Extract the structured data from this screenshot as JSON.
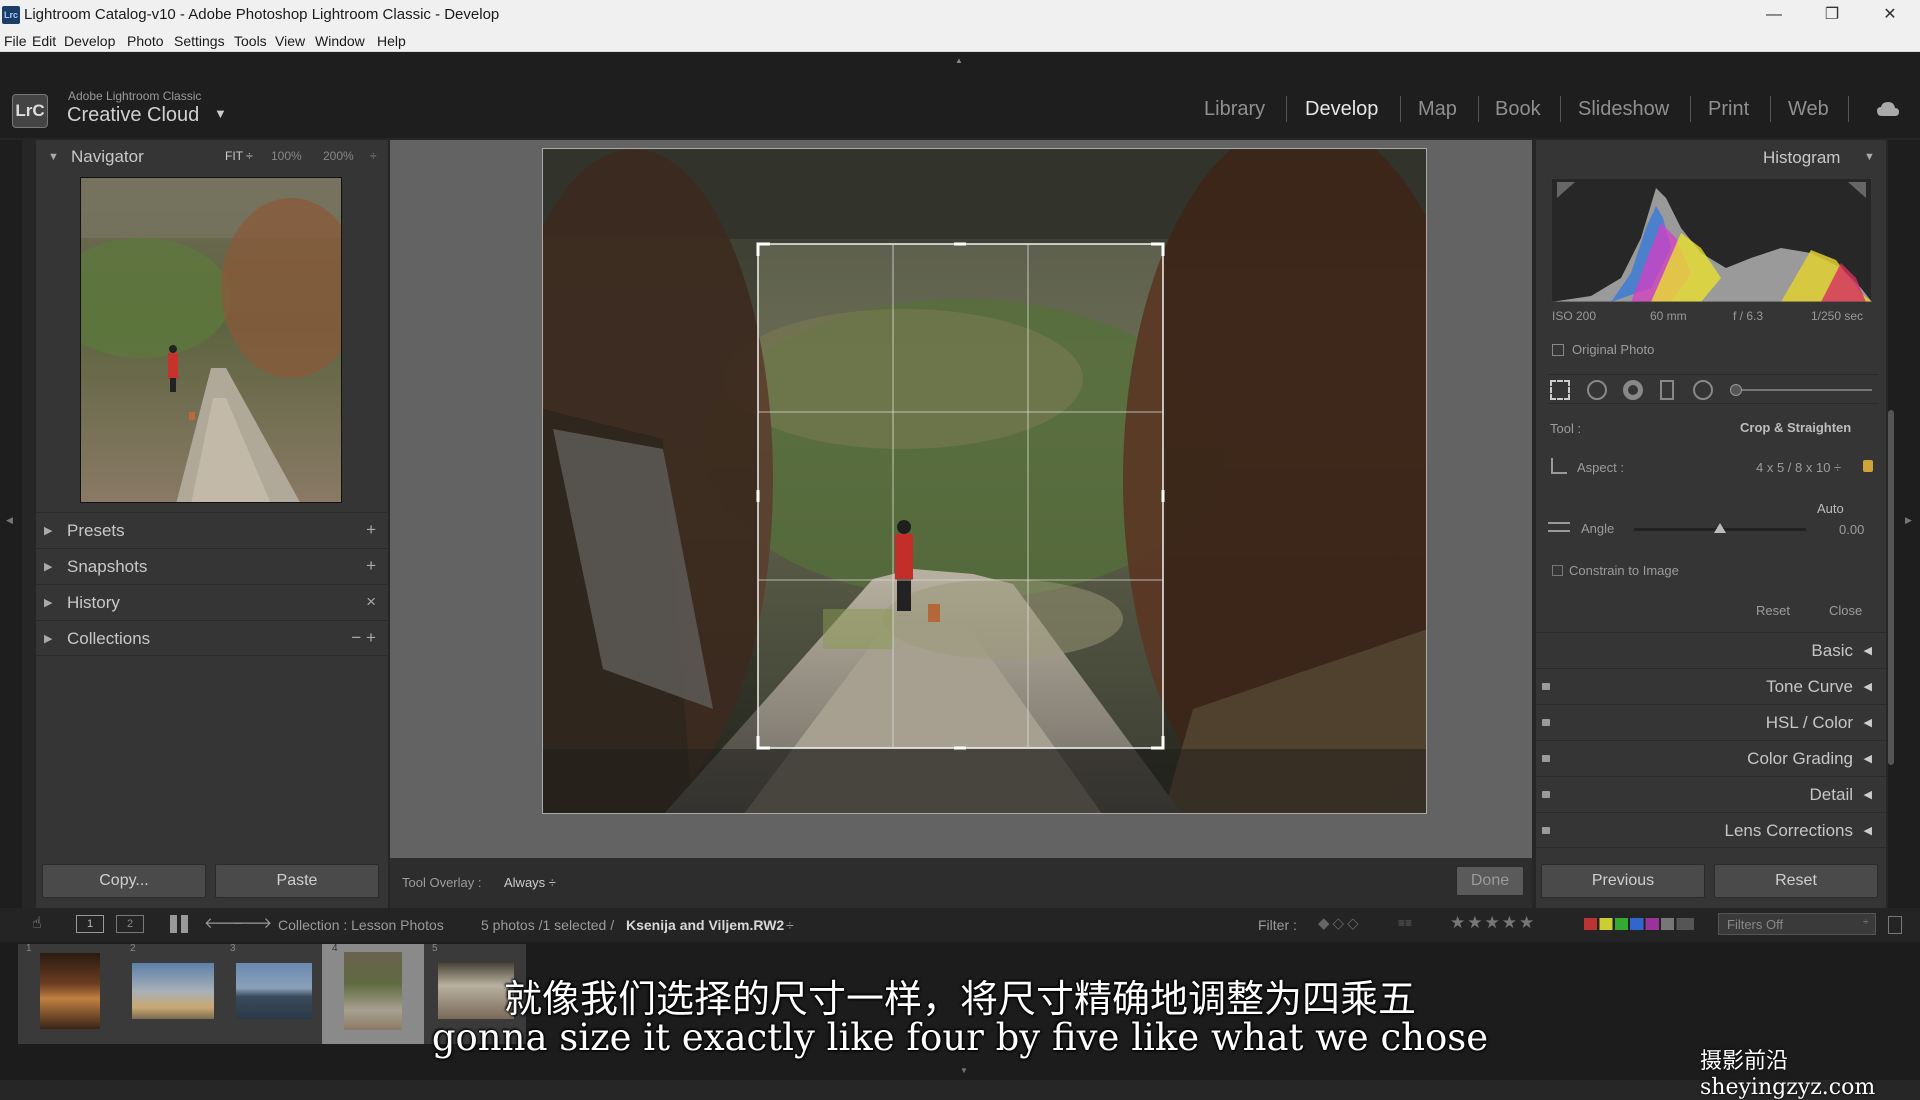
{
  "window": {
    "title": "Lightroom Catalog-v10 - Adobe Photoshop Lightroom Classic - Develop",
    "app_icon": "Lrc",
    "minimize": "—",
    "restore": "❐",
    "close": "✕"
  },
  "menu": [
    "File",
    "Edit",
    "Develop",
    "Photo",
    "Settings",
    "Tools",
    "View",
    "Window",
    "Help"
  ],
  "brand": {
    "logo": "LrC",
    "small": "Adobe Lightroom Classic",
    "big": "Creative Cloud",
    "arrow": "▼"
  },
  "modules": [
    "Library",
    "Develop",
    "Map",
    "Book",
    "Slideshow",
    "Print",
    "Web"
  ],
  "active_module": "Develop",
  "navigator": {
    "title": "Navigator",
    "zoom": [
      "FIT ÷",
      "100%",
      "200%",
      "÷"
    ]
  },
  "left_sections": [
    {
      "label": "Presets",
      "action": "+"
    },
    {
      "label": "Snapshots",
      "action": "+"
    },
    {
      "label": "History",
      "action": "×"
    },
    {
      "label": "Collections",
      "action": "−  +"
    }
  ],
  "left_buttons": {
    "copy": "Copy...",
    "paste": "Paste"
  },
  "toolbar": {
    "overlay_label": "Tool Overlay :",
    "overlay_value": "Always ÷",
    "done": "Done"
  },
  "histogram": {
    "title": "Histogram",
    "iso": "ISO 200",
    "focal": "60 mm",
    "aperture": "f / 6.3",
    "shutter": "1/250 sec",
    "original_photo": "Original Photo"
  },
  "crop_tool": {
    "tool_label": "Tool :",
    "tool_value": "Crop & Straighten",
    "aspect_label": "Aspect :",
    "aspect_value": "4 x 5  /  8 x 10 ÷",
    "auto": "Auto",
    "angle_label": "Angle",
    "angle_value": "0.00",
    "angle_position": 0.5,
    "constrain": "Constrain to Image",
    "reset": "Reset",
    "close": "Close"
  },
  "right_sections": [
    "Basic",
    "Tone Curve",
    "HSL / Color",
    "Color Grading",
    "Detail",
    "Lens Corrections"
  ],
  "right_buttons": {
    "previous": "Previous",
    "reset": "Reset"
  },
  "filterbar": {
    "screen_1": "1",
    "screen_2": "2",
    "collection": "Collection : Lesson Photos",
    "count": "5 photos /1 selected /",
    "file": "Ksenija and Viljem.RW2",
    "file_arrow": "÷",
    "filter_label": "Filter :",
    "filters_off": "Filters Off"
  },
  "filmstrip": {
    "numbers": [
      "1",
      "2",
      "3",
      "4",
      "5"
    ]
  },
  "subtitles": {
    "zh": "就像我们选择的尺寸一样，将尺寸精确地调整为四乘五",
    "en": "gonna size it exactly like four by five like what we chose"
  },
  "watermark": "摄影前沿sheyingzyz.com",
  "colors": {
    "accent": "#e6e6e6",
    "panel": "#353535",
    "canvas": "#636363"
  }
}
